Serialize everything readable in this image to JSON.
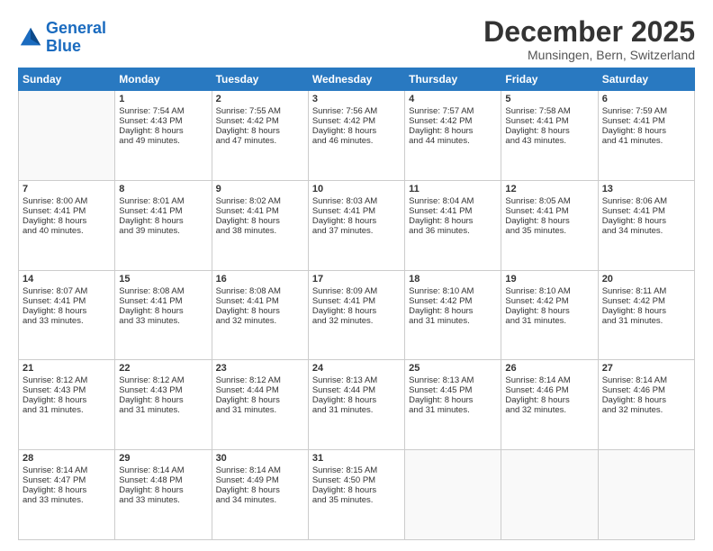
{
  "logo": {
    "line1": "General",
    "line2": "Blue"
  },
  "title": "December 2025",
  "location": "Munsingen, Bern, Switzerland",
  "header_days": [
    "Sunday",
    "Monday",
    "Tuesday",
    "Wednesday",
    "Thursday",
    "Friday",
    "Saturday"
  ],
  "weeks": [
    [
      {
        "day": "",
        "text": ""
      },
      {
        "day": "1",
        "text": "Sunrise: 7:54 AM\nSunset: 4:43 PM\nDaylight: 8 hours\nand 49 minutes."
      },
      {
        "day": "2",
        "text": "Sunrise: 7:55 AM\nSunset: 4:42 PM\nDaylight: 8 hours\nand 47 minutes."
      },
      {
        "day": "3",
        "text": "Sunrise: 7:56 AM\nSunset: 4:42 PM\nDaylight: 8 hours\nand 46 minutes."
      },
      {
        "day": "4",
        "text": "Sunrise: 7:57 AM\nSunset: 4:42 PM\nDaylight: 8 hours\nand 44 minutes."
      },
      {
        "day": "5",
        "text": "Sunrise: 7:58 AM\nSunset: 4:41 PM\nDaylight: 8 hours\nand 43 minutes."
      },
      {
        "day": "6",
        "text": "Sunrise: 7:59 AM\nSunset: 4:41 PM\nDaylight: 8 hours\nand 41 minutes."
      }
    ],
    [
      {
        "day": "7",
        "text": "Sunrise: 8:00 AM\nSunset: 4:41 PM\nDaylight: 8 hours\nand 40 minutes."
      },
      {
        "day": "8",
        "text": "Sunrise: 8:01 AM\nSunset: 4:41 PM\nDaylight: 8 hours\nand 39 minutes."
      },
      {
        "day": "9",
        "text": "Sunrise: 8:02 AM\nSunset: 4:41 PM\nDaylight: 8 hours\nand 38 minutes."
      },
      {
        "day": "10",
        "text": "Sunrise: 8:03 AM\nSunset: 4:41 PM\nDaylight: 8 hours\nand 37 minutes."
      },
      {
        "day": "11",
        "text": "Sunrise: 8:04 AM\nSunset: 4:41 PM\nDaylight: 8 hours\nand 36 minutes."
      },
      {
        "day": "12",
        "text": "Sunrise: 8:05 AM\nSunset: 4:41 PM\nDaylight: 8 hours\nand 35 minutes."
      },
      {
        "day": "13",
        "text": "Sunrise: 8:06 AM\nSunset: 4:41 PM\nDaylight: 8 hours\nand 34 minutes."
      }
    ],
    [
      {
        "day": "14",
        "text": "Sunrise: 8:07 AM\nSunset: 4:41 PM\nDaylight: 8 hours\nand 33 minutes."
      },
      {
        "day": "15",
        "text": "Sunrise: 8:08 AM\nSunset: 4:41 PM\nDaylight: 8 hours\nand 33 minutes."
      },
      {
        "day": "16",
        "text": "Sunrise: 8:08 AM\nSunset: 4:41 PM\nDaylight: 8 hours\nand 32 minutes."
      },
      {
        "day": "17",
        "text": "Sunrise: 8:09 AM\nSunset: 4:41 PM\nDaylight: 8 hours\nand 32 minutes."
      },
      {
        "day": "18",
        "text": "Sunrise: 8:10 AM\nSunset: 4:42 PM\nDaylight: 8 hours\nand 31 minutes."
      },
      {
        "day": "19",
        "text": "Sunrise: 8:10 AM\nSunset: 4:42 PM\nDaylight: 8 hours\nand 31 minutes."
      },
      {
        "day": "20",
        "text": "Sunrise: 8:11 AM\nSunset: 4:42 PM\nDaylight: 8 hours\nand 31 minutes."
      }
    ],
    [
      {
        "day": "21",
        "text": "Sunrise: 8:12 AM\nSunset: 4:43 PM\nDaylight: 8 hours\nand 31 minutes."
      },
      {
        "day": "22",
        "text": "Sunrise: 8:12 AM\nSunset: 4:43 PM\nDaylight: 8 hours\nand 31 minutes."
      },
      {
        "day": "23",
        "text": "Sunrise: 8:12 AM\nSunset: 4:44 PM\nDaylight: 8 hours\nand 31 minutes."
      },
      {
        "day": "24",
        "text": "Sunrise: 8:13 AM\nSunset: 4:44 PM\nDaylight: 8 hours\nand 31 minutes."
      },
      {
        "day": "25",
        "text": "Sunrise: 8:13 AM\nSunset: 4:45 PM\nDaylight: 8 hours\nand 31 minutes."
      },
      {
        "day": "26",
        "text": "Sunrise: 8:14 AM\nSunset: 4:46 PM\nDaylight: 8 hours\nand 32 minutes."
      },
      {
        "day": "27",
        "text": "Sunrise: 8:14 AM\nSunset: 4:46 PM\nDaylight: 8 hours\nand 32 minutes."
      }
    ],
    [
      {
        "day": "28",
        "text": "Sunrise: 8:14 AM\nSunset: 4:47 PM\nDaylight: 8 hours\nand 33 minutes."
      },
      {
        "day": "29",
        "text": "Sunrise: 8:14 AM\nSunset: 4:48 PM\nDaylight: 8 hours\nand 33 minutes."
      },
      {
        "day": "30",
        "text": "Sunrise: 8:14 AM\nSunset: 4:49 PM\nDaylight: 8 hours\nand 34 minutes."
      },
      {
        "day": "31",
        "text": "Sunrise: 8:15 AM\nSunset: 4:50 PM\nDaylight: 8 hours\nand 35 minutes."
      },
      {
        "day": "",
        "text": ""
      },
      {
        "day": "",
        "text": ""
      },
      {
        "day": "",
        "text": ""
      }
    ]
  ]
}
